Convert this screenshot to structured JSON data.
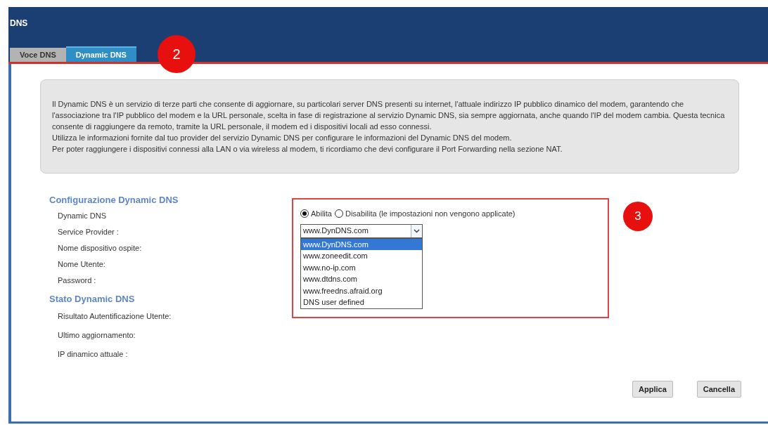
{
  "window": {
    "title": "DNS"
  },
  "tabs": [
    {
      "label": "Voce DNS",
      "selected": false
    },
    {
      "label": "Dynamic DNS",
      "selected": true
    }
  ],
  "info": [
    "Il Dynamic DNS è un servizio di terze parti che consente di aggiornare, su particolari server DNS presenti su internet, l'attuale indirizzo IP pubblico dinamico del modem, garantendo che l'associazione tra l'IP pubblico del modem e la URL personale, scelta in fase di registrazione al servizio Dynamic DNS, sia sempre aggiornata, anche quando l'IP del modem cambia. Questa tecnica consente di raggiungere da remoto, tramite la URL personale, il modem ed i dispositivi locali ad esso connessi.",
    "Utilizza le informazioni fornite dal tuo provider del servizio Dynamic DNS per configurare le informazioni del Dynamic DNS del modem.",
    "Per poter raggiungere i dispositivi connessi alla LAN o via wireless al modem, ti ricordiamo che devi configurare il Port Forwarding nella sezione NAT."
  ],
  "config": {
    "heading": "Configurazione Dynamic DNS",
    "labels": [
      "Dynamic DNS",
      "Service Provider :",
      "Nome dispositivo ospite:",
      "Nome Utente:",
      "Password :"
    ]
  },
  "status": {
    "heading": "Stato Dynamic DNS",
    "labels": [
      "Risultato Autentificazione Utente:",
      "Ultimo aggiornamento:",
      "IP dinamico attuale :"
    ]
  },
  "radios": [
    {
      "label": "Abilita",
      "selected": true
    },
    {
      "label": "Disabilita (le impostazioni non vengono applicate)",
      "selected": false
    }
  ],
  "service_provider": {
    "value": "www.DynDNS.com",
    "options": [
      {
        "label": "www.DynDNS.com",
        "selected": true
      },
      {
        "label": "www.zoneedit.com",
        "selected": false
      },
      {
        "label": "www.no-ip.com",
        "selected": false
      },
      {
        "label": "www.dtdns.com",
        "selected": false
      },
      {
        "label": "www.freedns.afraid.org",
        "selected": false
      },
      {
        "label": "DNS user defined",
        "selected": false
      }
    ]
  },
  "buttons": [
    "Applica",
    "Cancella"
  ],
  "annotations": [
    {
      "label": "2"
    },
    {
      "label": "3"
    }
  ]
}
